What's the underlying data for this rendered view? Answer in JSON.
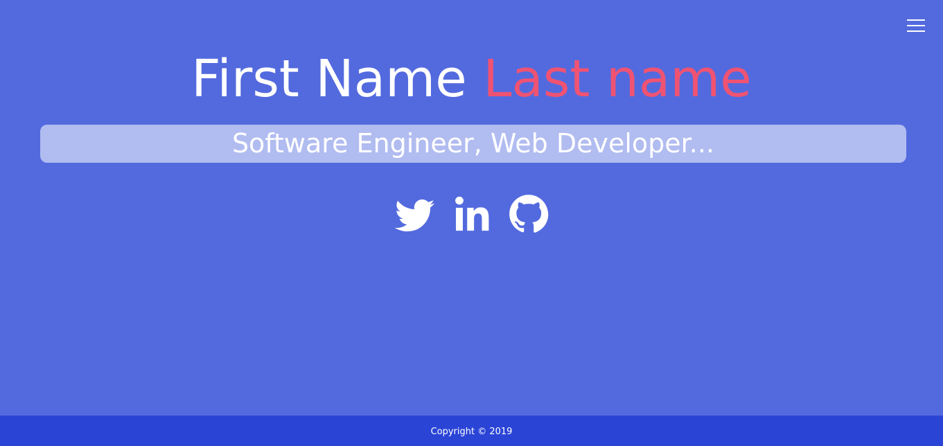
{
  "hero": {
    "first_name": "First Name",
    "last_name": "Last name",
    "subtitle": "Software Engineer, Web Developer..."
  },
  "social": [
    {
      "name": "twitter-icon"
    },
    {
      "name": "linkedin-icon"
    },
    {
      "name": "github-icon"
    }
  ],
  "footer": {
    "copyright": "Copyright © 2019"
  },
  "colors": {
    "background": "#536ade",
    "accent": "#f05372",
    "footer": "#2a44d6"
  }
}
